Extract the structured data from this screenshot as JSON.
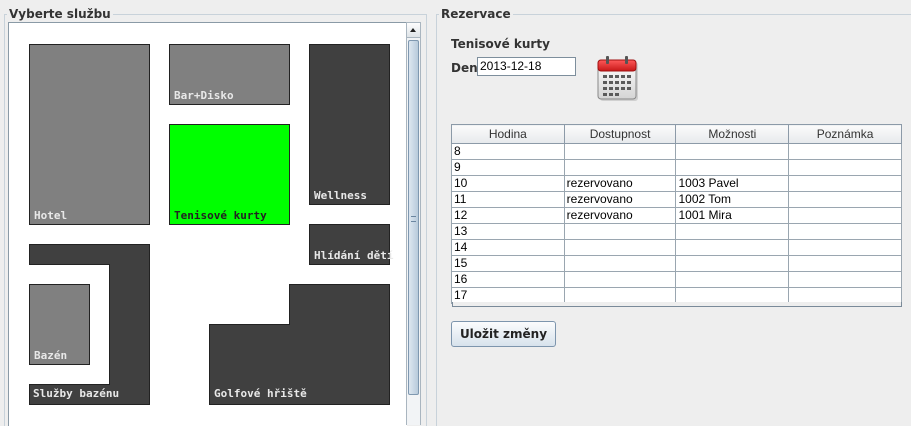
{
  "left_panel": {
    "title": "Vyberte službu",
    "services": [
      {
        "label": "Hotel",
        "fill": "gray"
      },
      {
        "label": "Bar+Disko",
        "fill": "gray"
      },
      {
        "label": "Wellness",
        "fill": "dark"
      },
      {
        "label": "Tenisové kurty",
        "fill": "green",
        "selected": true
      },
      {
        "label": "Hlídání dětí",
        "fill": "dark"
      },
      {
        "label": "Bazén",
        "fill": "gray"
      },
      {
        "label": "Služby bazénu",
        "fill": "dark"
      },
      {
        "label": "Golfové hřiště",
        "fill": "dark"
      }
    ]
  },
  "right_panel": {
    "title": "Rezervace",
    "service_name": "Tenisové kurty",
    "date_label": "Den:",
    "date_value": "2013-12-18",
    "calendar_icon": "calendar-icon",
    "table": {
      "columns": [
        "Hodina",
        "Dostupnost",
        "Možnosti",
        "Poznámka"
      ],
      "rows": [
        [
          "8",
          "",
          "",
          ""
        ],
        [
          "9",
          "",
          "",
          ""
        ],
        [
          "10",
          "rezervovano",
          "1003 Pavel",
          ""
        ],
        [
          "11",
          "rezervovano",
          "1002 Tom",
          ""
        ],
        [
          "12",
          "rezervovano",
          "1001 Mira",
          ""
        ],
        [
          "13",
          "",
          "",
          ""
        ],
        [
          "14",
          "",
          "",
          ""
        ],
        [
          "15",
          "",
          "",
          ""
        ],
        [
          "16",
          "",
          "",
          ""
        ],
        [
          "17",
          "",
          "",
          ""
        ]
      ]
    },
    "save_label": "Uložit změny"
  },
  "colors": {
    "selected": "#00ff00",
    "room_gray": "#808080",
    "room_dark": "#404040",
    "background": "#eeeeee"
  }
}
